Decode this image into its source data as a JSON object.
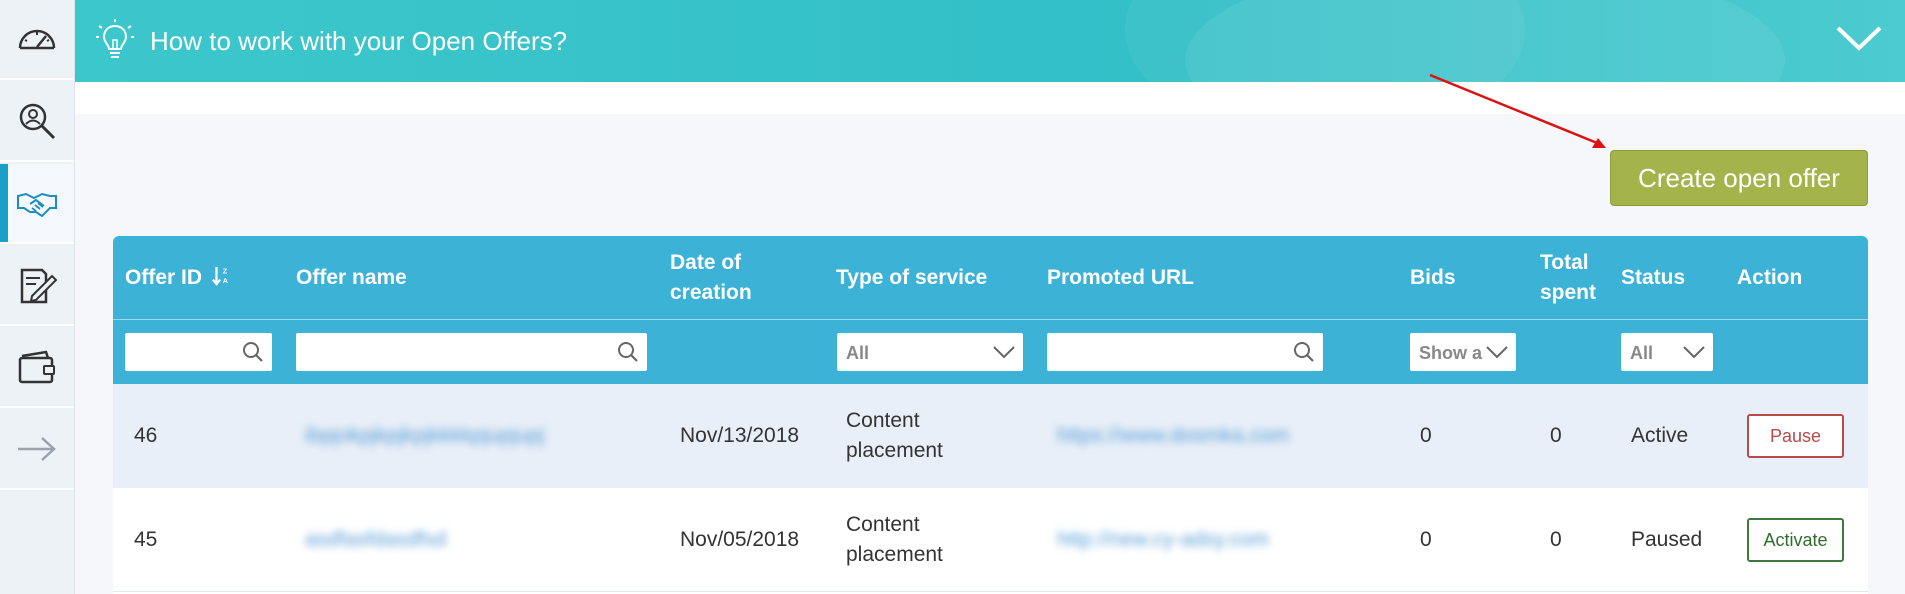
{
  "banner": {
    "title": "How to work with your Open Offers?"
  },
  "toolbar": {
    "create_label": "Create open offer"
  },
  "table": {
    "headers": {
      "offer_id": "Offer ID",
      "offer_name": "Offer name",
      "date_line1": "Date of",
      "date_line2": "creation",
      "type_of_service": "Type of service",
      "promoted_url": "Promoted URL",
      "bids": "Bids",
      "total_line1": "Total",
      "total_line2": "spent",
      "status": "Status",
      "action": "Action"
    },
    "filters": {
      "type_value": "All",
      "bids_value": "Show a",
      "status_value": "All"
    },
    "rows": [
      {
        "id": "46",
        "name": "ibpjokpjkpjkpjkkkkpjupjupj",
        "date": "Nov/13/2018",
        "type_line1": "Content",
        "type_line2": "placement",
        "url": "https://www.dosmka.com",
        "bids": "0",
        "spent": "0",
        "status": "Active",
        "action": "Pause"
      },
      {
        "id": "45",
        "name": "asdfasfdasdfsd",
        "date": "Nov/05/2018",
        "type_line1": "Content",
        "type_line2": "placement",
        "url": "http://new.cy-adsy.com",
        "bids": "0",
        "spent": "0",
        "status": "Paused",
        "action": "Activate"
      }
    ]
  },
  "colors": {
    "banner": "#3cc7cc",
    "header": "#3bb2d6",
    "create_button": "#a4b34a",
    "pause": "#b84a4a",
    "activate": "#2f6d2f"
  }
}
